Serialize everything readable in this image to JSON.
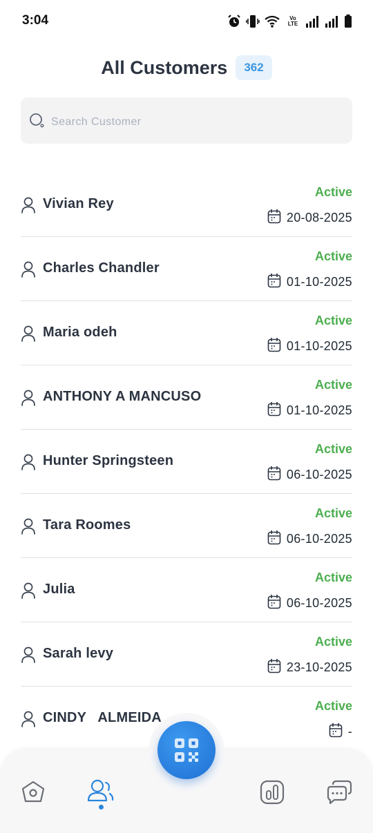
{
  "status_bar": {
    "time": "3:04",
    "network_label": "Vo LTE"
  },
  "header": {
    "title": "All Customers",
    "count": "362"
  },
  "search": {
    "placeholder": "Search Customer"
  },
  "customers": [
    {
      "name": "Vivian Rey",
      "status": "Active",
      "date": "20-08-2025"
    },
    {
      "name": "Charles Chandler",
      "status": "Active",
      "date": "01-10-2025"
    },
    {
      "name": "Maria odeh",
      "status": "Active",
      "date": "01-10-2025"
    },
    {
      "name": "ANTHONY A MANCUSO",
      "status": "Active",
      "date": "01-10-2025"
    },
    {
      "name": "Hunter Springsteen",
      "status": "Active",
      "date": "06-10-2025"
    },
    {
      "name": "Tara Roomes",
      "status": "Active",
      "date": "06-10-2025"
    },
    {
      "name": "Julia",
      "status": "Active",
      "date": "06-10-2025"
    },
    {
      "name": "Sarah levy",
      "status": "Active",
      "date": "23-10-2025"
    },
    {
      "name": "CINDY   ALMEIDA",
      "status": "Active",
      "date": "-"
    }
  ],
  "nav": {
    "items": [
      "home-icon",
      "customers-icon",
      "reports-icon",
      "messages-icon"
    ],
    "active": "customers-icon",
    "fab_icon": "qr-code-icon",
    "accent": "#2b86dd"
  },
  "colors": {
    "active_status": "#4cae4f",
    "badge_bg": "#e7f2fc",
    "badge_text": "#3d96e0"
  }
}
